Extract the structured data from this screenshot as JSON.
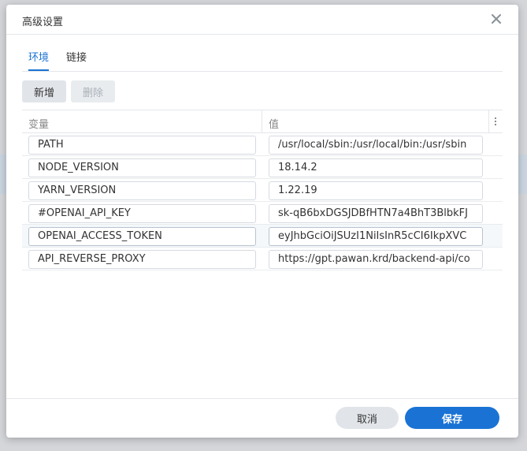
{
  "dialog": {
    "title": "高级设置",
    "close_icon": "close-icon"
  },
  "tabs": [
    {
      "label": "环境",
      "active": true
    },
    {
      "label": "链接",
      "active": false
    }
  ],
  "toolbar": {
    "add_label": "新增",
    "delete_label": "删除",
    "delete_disabled": true
  },
  "grid": {
    "columns": [
      "变量",
      "值"
    ],
    "menu_icon": "vertical-ellipsis-icon",
    "rows": [
      {
        "name": "PATH",
        "value": "/usr/local/sbin:/usr/local/bin:/usr/sbin"
      },
      {
        "name": "NODE_VERSION",
        "value": "18.14.2"
      },
      {
        "name": "YARN_VERSION",
        "value": "1.22.19"
      },
      {
        "name": "#OPENAI_API_KEY",
        "value": "sk-qB6bxDGSJDBfHTN7a4BhT3BlbkFJ"
      },
      {
        "name": "OPENAI_ACCESS_TOKEN",
        "value": "eyJhbGciOiJSUzI1NiIsInR5cCI6IkpXVC"
      },
      {
        "name": "API_REVERSE_PROXY",
        "value": "https://gpt.pawan.krd/backend-api/co"
      }
    ]
  },
  "footer": {
    "cancel_label": "取消",
    "save_label": "保存"
  },
  "colors": {
    "accent": "#1a73d4",
    "button_bg": "#e1e5ea",
    "border": "#e3e6ea"
  }
}
